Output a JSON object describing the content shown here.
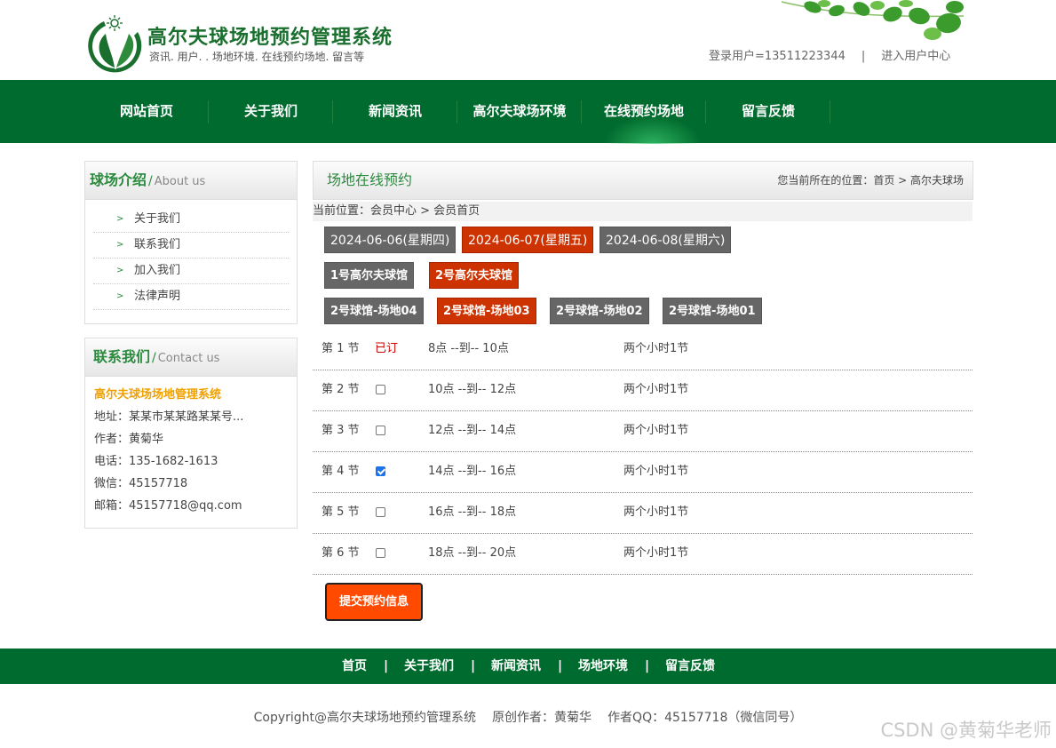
{
  "header": {
    "title": "高尔夫球场地预约管理系统",
    "subtitle": "资讯. 用户. . 场地环境. 在线预约场地. 留言等",
    "login_user": "登录用户=13511223344",
    "separator": "|",
    "user_center": "进入用户中心"
  },
  "nav": {
    "items": [
      "网站首页",
      "关于我们",
      "新闻资讯",
      "高尔夫球场环境",
      "在线预约场地",
      "留言反馈"
    ]
  },
  "sidebar": {
    "about": {
      "title_cn": "球场介绍",
      "title_en": "About us",
      "items": [
        "关于我们",
        "联系我们",
        "加入我们",
        "法律声明"
      ]
    },
    "contact": {
      "title_cn": "联系我们",
      "title_en": "Contact us",
      "name": "高尔夫球场场地管理系统",
      "address": "地址：某某市某某路某某号...",
      "author": "作者：黄菊华",
      "phone": "电话：135-1682-1613",
      "wechat": "微信：45157718",
      "email": "邮箱：45157718@qq.com"
    }
  },
  "main": {
    "title": "场地在线预约",
    "breadcrumb": "您当前所在的位置：首页 > 高尔夫球场",
    "location": "当前位置：会员中心 > 会员首页",
    "dates": [
      {
        "label": "2024-06-06(星期四)",
        "selected": false
      },
      {
        "label": "2024-06-07(星期五)",
        "selected": true
      },
      {
        "label": "2024-06-08(星期六)",
        "selected": false
      }
    ],
    "halls": [
      {
        "label": "1号高尔夫球馆",
        "selected": false
      },
      {
        "label": "2号高尔夫球馆",
        "selected": true
      }
    ],
    "courts": [
      {
        "label": "2号球馆-场地04",
        "selected": false
      },
      {
        "label": "2号球馆-场地03",
        "selected": true
      },
      {
        "label": "2号球馆-场地02",
        "selected": false
      },
      {
        "label": "2号球馆-场地01",
        "selected": false
      }
    ],
    "slots": [
      {
        "no": "第 1 节",
        "status": "已订",
        "booked": true,
        "checked": false,
        "time": "8点 --到-- 10点",
        "duration": "两个小时1节"
      },
      {
        "no": "第 2 节",
        "status": "",
        "booked": false,
        "checked": false,
        "time": "10点 --到-- 12点",
        "duration": "两个小时1节"
      },
      {
        "no": "第 3 节",
        "status": "",
        "booked": false,
        "checked": false,
        "time": "12点 --到-- 14点",
        "duration": "两个小时1节"
      },
      {
        "no": "第 4 节",
        "status": "",
        "booked": false,
        "checked": true,
        "time": "14点 --到-- 16点",
        "duration": "两个小时1节"
      },
      {
        "no": "第 5 节",
        "status": "",
        "booked": false,
        "checked": false,
        "time": "16点 --到-- 18点",
        "duration": "两个小时1节"
      },
      {
        "no": "第 6 节",
        "status": "",
        "booked": false,
        "checked": false,
        "time": "18点 --到-- 20点",
        "duration": "两个小时1节"
      }
    ],
    "submit_label": "提交预约信息"
  },
  "footer": {
    "nav": [
      "首页",
      "关于我们",
      "新闻资讯",
      "场地环境",
      "留言反馈"
    ],
    "separator": "|",
    "copyright": "Copyright@高尔夫球场地预约管理系统",
    "author": "原创作者：黄菊华",
    "qq": "作者QQ：45157718（微信同号）"
  },
  "watermark": "CSDN @黄菊华老师",
  "colors": {
    "nav_green": "#006b2e",
    "accent_red": "#cc3300",
    "button_orange": "#ff4a00",
    "tag_gray": "#666666"
  }
}
